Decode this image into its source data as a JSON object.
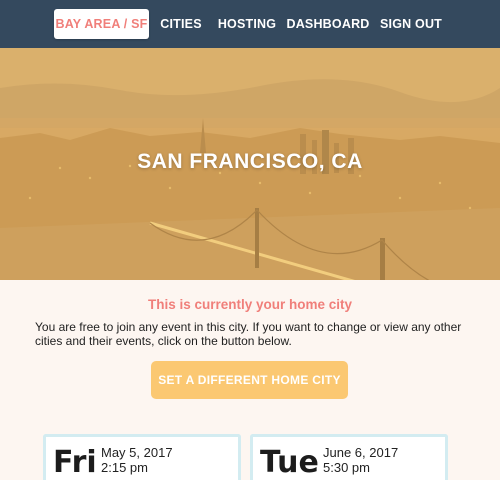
{
  "nav": {
    "items": [
      {
        "label": "BAY AREA / SF",
        "active": true
      },
      {
        "label": "CITIES"
      },
      {
        "label": "HOSTING"
      },
      {
        "label": "DASHBOARD"
      },
      {
        "label": "SIGN OUT"
      }
    ]
  },
  "hero": {
    "title": "SAN FRANCISCO, CA"
  },
  "home": {
    "heading": "This is currently your home city",
    "description": "You are free to join any event in this city. If you want to change or view any other cities and their events, click on the button below.",
    "button_label": "SET A DIFFERENT HOME CITY"
  },
  "events": [
    {
      "day": "Fri",
      "date": "May 5, 2017",
      "time": "2:15 pm"
    },
    {
      "day": "Tue",
      "date": "June 6, 2017",
      "time": "5:30 pm"
    }
  ],
  "colors": {
    "navbar": "#34495e",
    "accent": "#f07f7a",
    "button": "#fbc872",
    "card_border": "#d3ecf1",
    "page_bg": "#fdf6f1"
  }
}
